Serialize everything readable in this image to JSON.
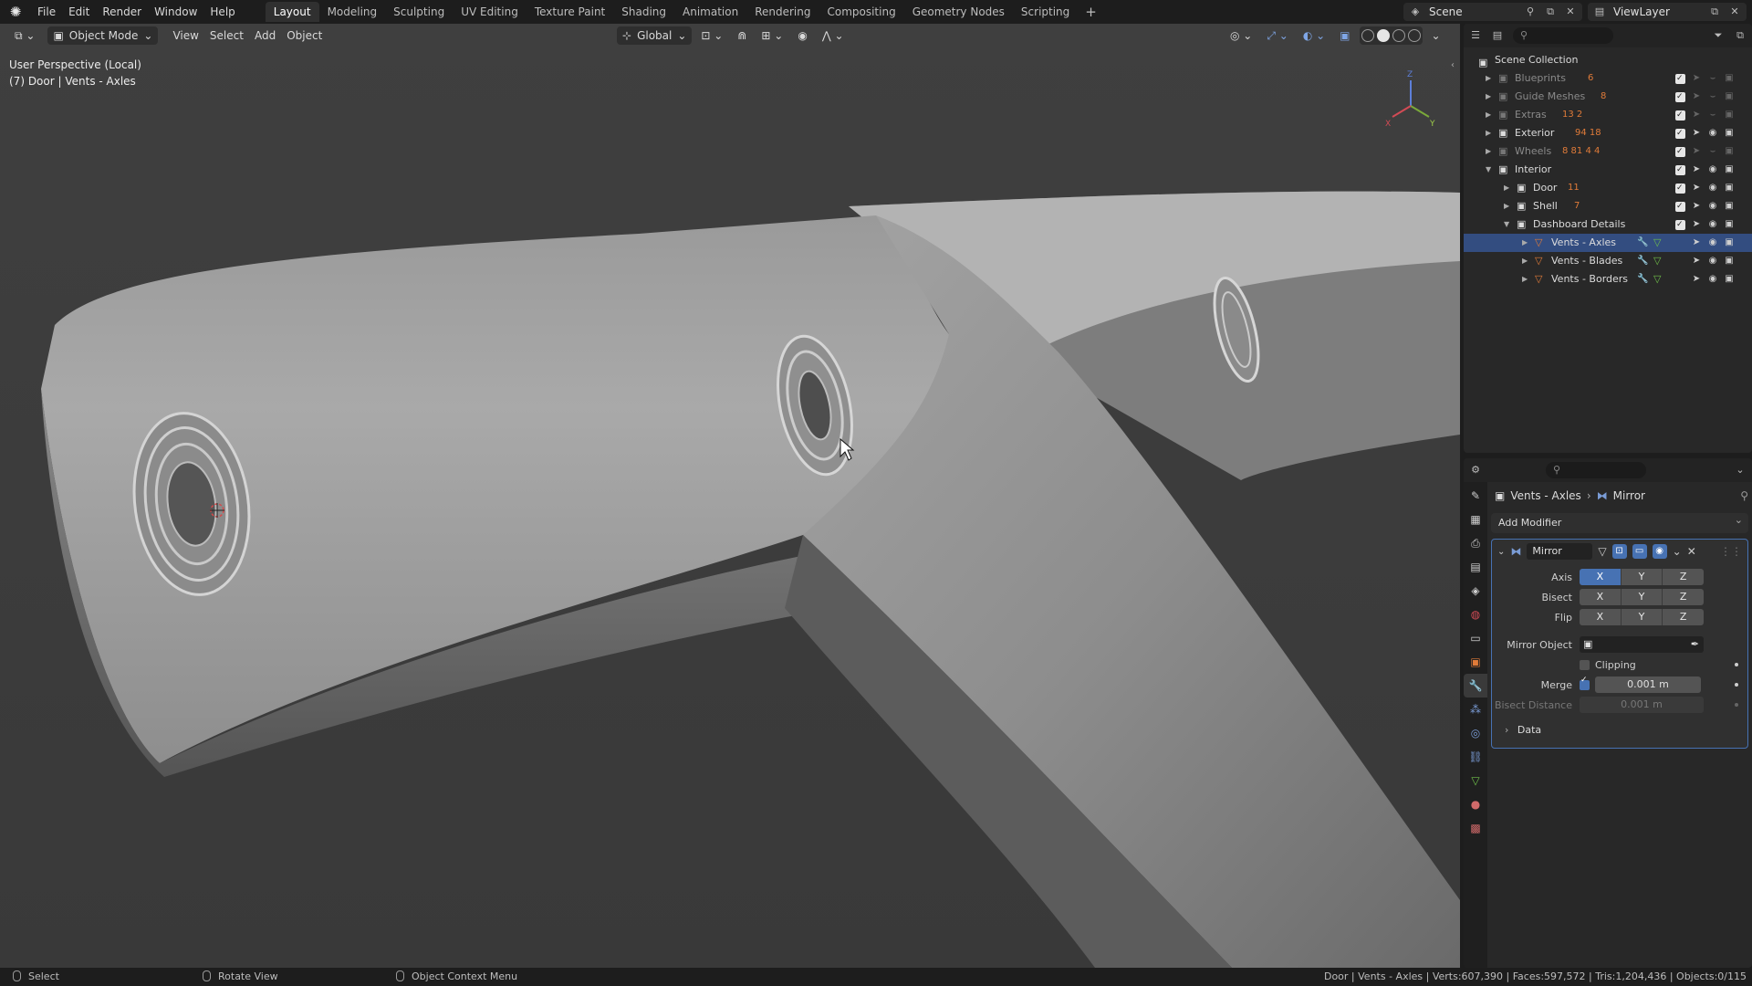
{
  "menu": {
    "items": [
      "File",
      "Edit",
      "Render",
      "Window",
      "Help"
    ]
  },
  "workspaces": {
    "tabs": [
      "Layout",
      "Modeling",
      "Sculpting",
      "UV Editing",
      "Texture Paint",
      "Shading",
      "Animation",
      "Rendering",
      "Compositing",
      "Geometry Nodes",
      "Scripting"
    ],
    "active": "Layout"
  },
  "scene": {
    "name": "Scene"
  },
  "view_layer": {
    "name": "ViewLayer"
  },
  "viewport": {
    "mode": "Object Mode",
    "menus": [
      "View",
      "Select",
      "Add",
      "Object"
    ],
    "orientation": "Global",
    "perspective": "User Perspective (Local)",
    "object_info": "(7) Door | Vents - Axles",
    "gizmo_axes": {
      "z": "Z",
      "y": "Y",
      "x": "X"
    }
  },
  "outliner": {
    "root": "Scene Collection",
    "rows": [
      {
        "name": "Blueprints",
        "depth": 0,
        "expanded": false,
        "dim": true,
        "kind": "collection",
        "extra": "6"
      },
      {
        "name": "Guide Meshes",
        "depth": 0,
        "expanded": false,
        "dim": true,
        "kind": "collection",
        "extra": "8"
      },
      {
        "name": "Extras",
        "depth": 0,
        "expanded": false,
        "dim": true,
        "kind": "collection",
        "extra": "13 2"
      },
      {
        "name": "Exterior",
        "depth": 0,
        "expanded": false,
        "dim": false,
        "kind": "collection",
        "extra": "94 18"
      },
      {
        "name": "Wheels",
        "depth": 0,
        "expanded": false,
        "dim": true,
        "kind": "collection",
        "extra": "8 81 4 4"
      },
      {
        "name": "Interior",
        "depth": 0,
        "expanded": true,
        "dim": false,
        "kind": "collection",
        "extra": ""
      },
      {
        "name": "Door",
        "depth": 1,
        "expanded": false,
        "dim": false,
        "kind": "collection",
        "extra": "11"
      },
      {
        "name": "Shell",
        "depth": 1,
        "expanded": false,
        "dim": false,
        "kind": "collection",
        "extra": "7"
      },
      {
        "name": "Dashboard Details",
        "depth": 1,
        "expanded": true,
        "dim": false,
        "kind": "collection",
        "extra": ""
      },
      {
        "name": "Vents - Axles",
        "depth": 2,
        "expanded": false,
        "dim": false,
        "kind": "mesh",
        "extra": "",
        "selected": true
      },
      {
        "name": "Vents - Blades",
        "depth": 2,
        "expanded": false,
        "dim": false,
        "kind": "mesh",
        "extra": ""
      },
      {
        "name": "Vents - Borders",
        "depth": 2,
        "expanded": false,
        "dim": false,
        "kind": "mesh",
        "extra": ""
      }
    ]
  },
  "properties": {
    "breadcrumb": {
      "object": "Vents - Axles",
      "modifier": "Mirror"
    },
    "add_modifier_label": "Add Modifier",
    "modifier": {
      "name": "Mirror",
      "axis_label": "Axis",
      "bisect_label": "Bisect",
      "flip_label": "Flip",
      "axis": {
        "x": "X",
        "y": "Y",
        "z": "Z"
      },
      "axis_enabled": [
        "X"
      ],
      "mirror_object_label": "Mirror Object",
      "mirror_object_value": "",
      "clipping_label": "Clipping",
      "clipping": false,
      "merge_label": "Merge",
      "merge": true,
      "merge_value": "0.001 m",
      "bisect_distance_label": "Bisect Distance",
      "bisect_distance_value": "0.001 m",
      "data_label": "Data"
    }
  },
  "statusbar": {
    "select": "Select",
    "rotate": "Rotate View",
    "context": "Object Context Menu",
    "stats": "Door | Vents - Axles | Verts:607,390 | Faces:597,572 | Tris:1,204,436 | Objects:0/115"
  },
  "colors": {
    "accent": "#4772b3",
    "selected_row": "#334d80",
    "mesh_icon": "#e07b39",
    "modifier_icon": "#7a9cd6",
    "data_icon": "#6fbf4a"
  }
}
